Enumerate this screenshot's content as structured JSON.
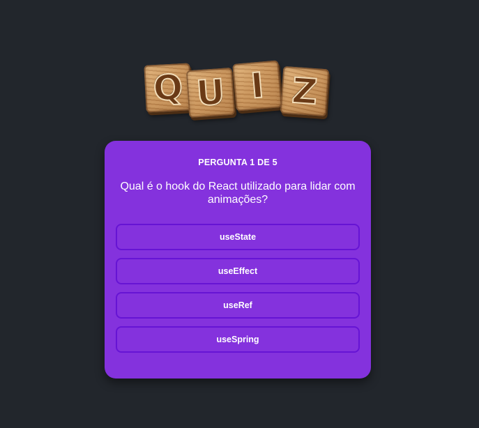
{
  "logo": {
    "letters": [
      "Q",
      "U",
      "I",
      "Z"
    ]
  },
  "quiz": {
    "question_count": "PERGUNTA 1 DE 5",
    "question": "Qual é o hook do React utilizado para lidar com animações?",
    "answers": [
      {
        "label": "useState"
      },
      {
        "label": "useEffect"
      },
      {
        "label": "useRef"
      },
      {
        "label": "useSpring"
      }
    ]
  },
  "colors": {
    "background": "#22262c",
    "card": "#8432dd",
    "answer_border": "#6614d4",
    "text": "#ffffff"
  }
}
